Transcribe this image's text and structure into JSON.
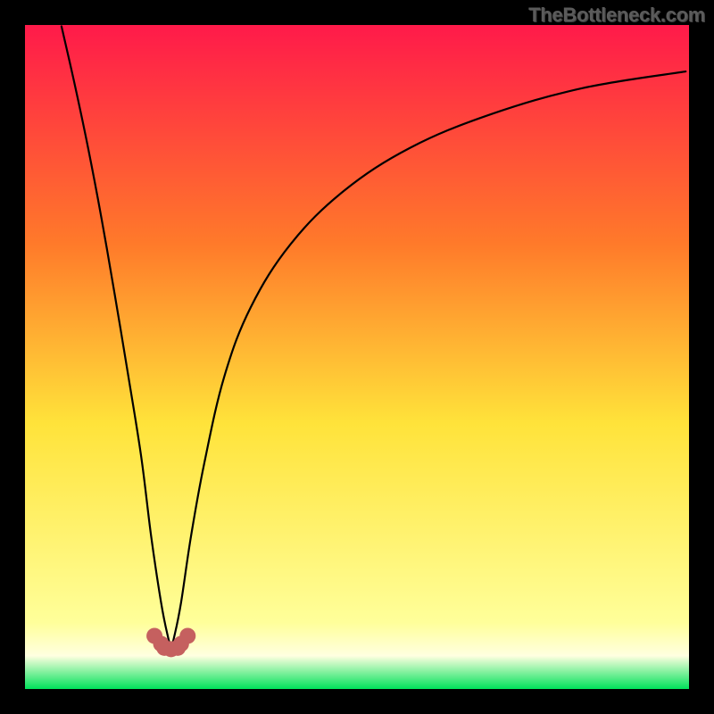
{
  "watermark": "TheBottleneck.com",
  "chart_data": {
    "type": "line",
    "title": "",
    "xlabel": "",
    "ylabel": "",
    "xlim": [
      0,
      100
    ],
    "ylim": [
      0,
      100
    ],
    "grid": false,
    "legend": null,
    "annotations": [],
    "background_gradient_stops": [
      {
        "offset": 0.0,
        "color": "#ff1a4a"
      },
      {
        "offset": 0.33,
        "color": "#ff7a2a"
      },
      {
        "offset": 0.6,
        "color": "#ffe33a"
      },
      {
        "offset": 0.9,
        "color": "#ffff9a"
      },
      {
        "offset": 0.95,
        "color": "#ffffe0"
      },
      {
        "offset": 1.0,
        "color": "#00e25a"
      }
    ],
    "curve_vertex_x": 22,
    "curve_bottom_y": 6,
    "series": [
      {
        "name": "bottleneck-curve",
        "x": [
          5.5,
          7.5,
          9.5,
          11.5,
          13.5,
          15.5,
          17.5,
          19.0,
          20.5,
          21.5,
          22.0,
          22.5,
          23.5,
          25.0,
          27.0,
          30.0,
          34.0,
          40.0,
          48.0,
          58.0,
          70.0,
          84.0,
          99.5
        ],
        "values": [
          99.8,
          91.0,
          81.5,
          71.0,
          59.5,
          47.5,
          35.0,
          23.0,
          13.0,
          8.0,
          6.5,
          8.0,
          13.0,
          23.0,
          34.0,
          47.0,
          57.5,
          67.0,
          75.0,
          81.5,
          86.5,
          90.5,
          93.0
        ]
      },
      {
        "name": "bottom-marker",
        "x": [
          19.5,
          20.5,
          21.0,
          22.0,
          23.0,
          23.5,
          24.5
        ],
        "values": [
          8.0,
          6.8,
          6.2,
          6.0,
          6.2,
          6.8,
          8.0
        ]
      }
    ],
    "colors": {
      "bottleneck-curve": "#000000",
      "bottom-marker": "#c5605f"
    }
  }
}
